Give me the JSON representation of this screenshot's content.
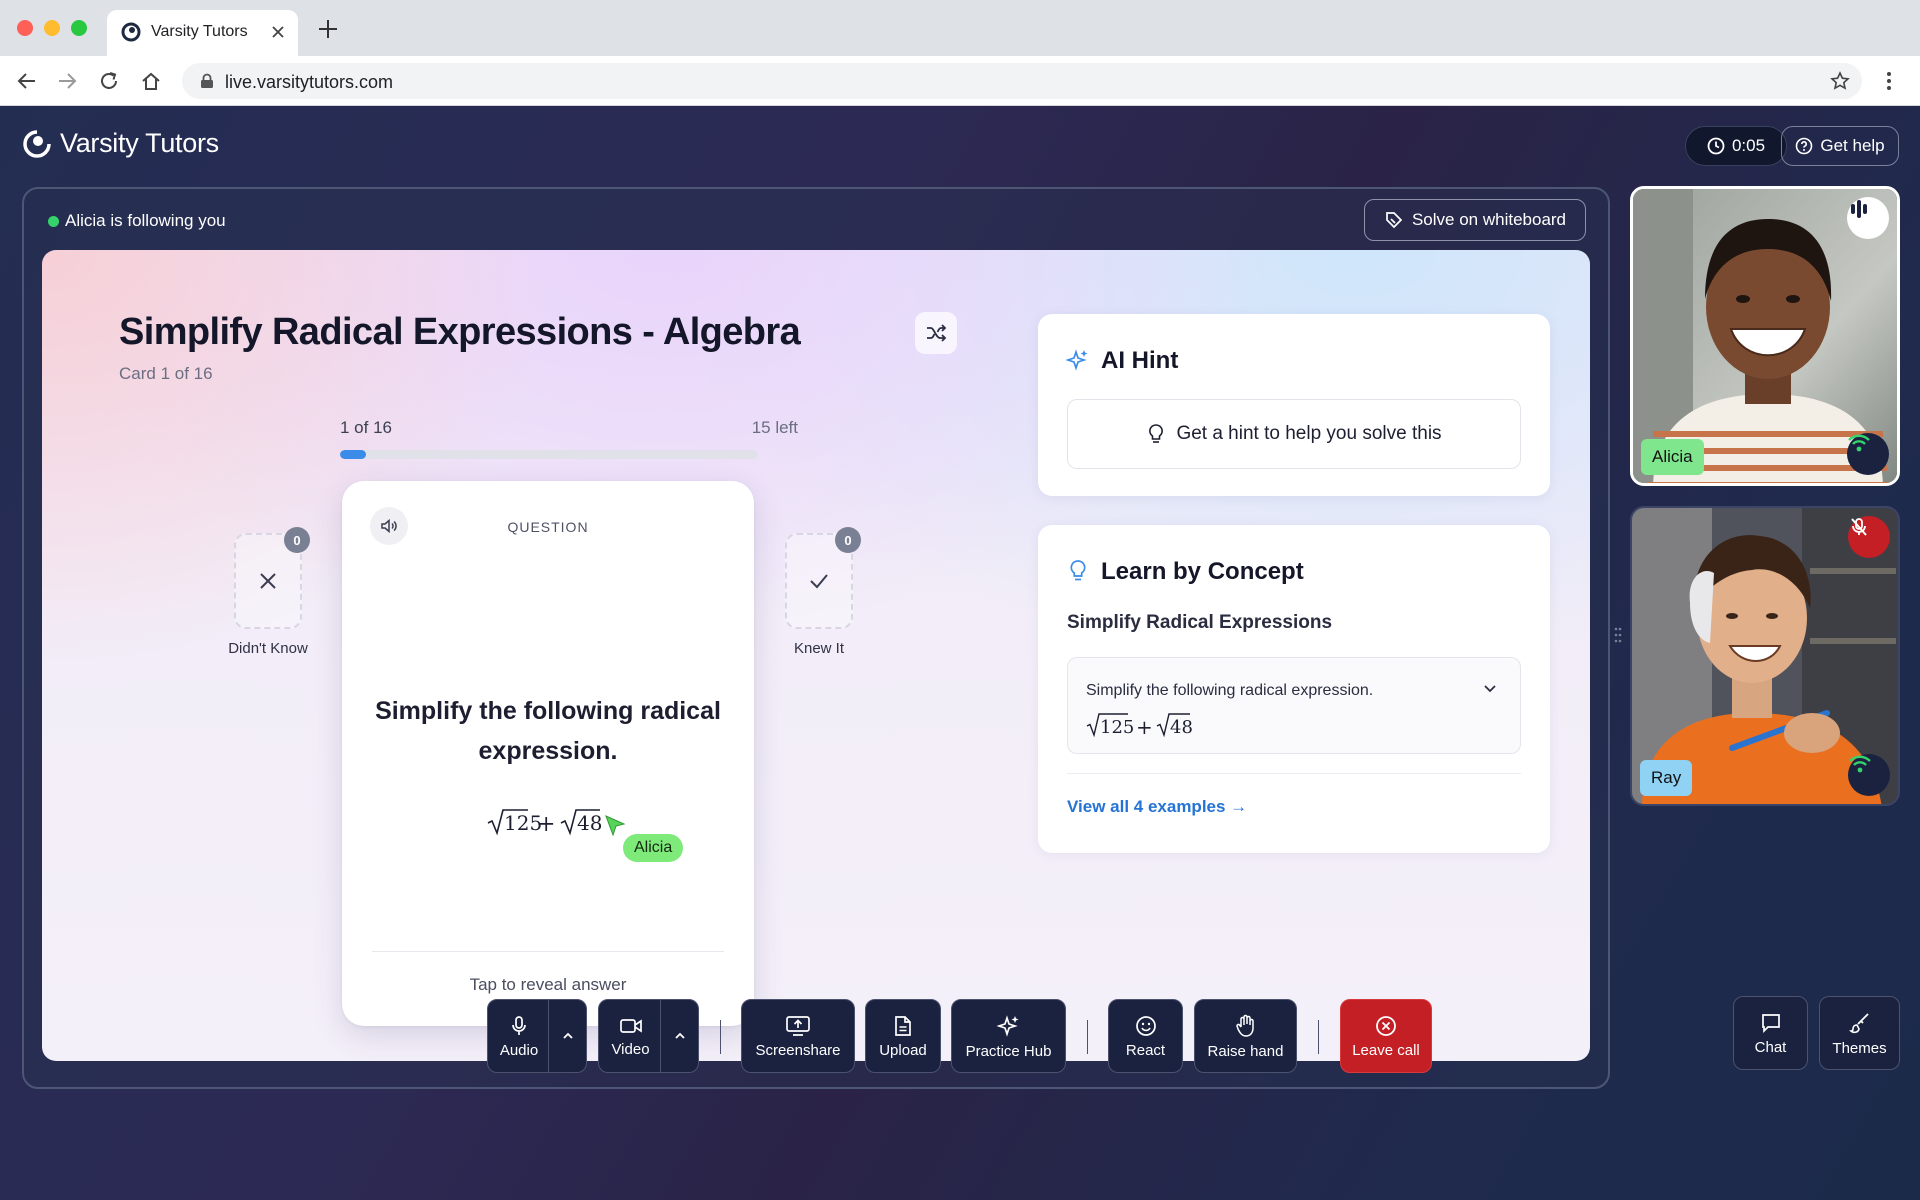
{
  "browser": {
    "tab_title": "Varsity Tutors",
    "url": "live.varsitytutors.com"
  },
  "app": {
    "brand": "Varsity Tutors",
    "timer": "0:05",
    "help_label": "Get help",
    "follow_status": "Alicia is following you",
    "whiteboard_label": "Solve on whiteboard"
  },
  "deck": {
    "title": "Simplify Radical Expressions - Algebra",
    "subtitle": "Card 1 of 16",
    "progress_label": "1 of 16",
    "remaining_label": "15 left",
    "progress_fraction": 0.0625,
    "didnt_know_label": "Didn't Know",
    "didnt_know_count": "0",
    "knew_it_label": "Knew It",
    "knew_it_count": "0"
  },
  "card": {
    "label": "QUESTION",
    "question": "Simplify the following radical expression.",
    "expression": "√125 + √48",
    "reveal": "Tap to reveal answer",
    "cursor_user": "Alicia"
  },
  "hint": {
    "title": "AI Hint",
    "button": "Get a hint to help you solve this"
  },
  "concept": {
    "title": "Learn by Concept",
    "subtitle": "Simplify Radical Expressions",
    "example_text": "Simplify the following radical expression.",
    "example_expression": "√125 + √48",
    "view_all": "View all 4 examples →"
  },
  "participants": [
    {
      "name": "Alicia",
      "status": "speaking",
      "tag_color": "#7fe68e"
    },
    {
      "name": "Ray",
      "status": "muted",
      "tag_color": "#8fd2f4"
    }
  ],
  "toolbar": {
    "audio": "Audio",
    "video": "Video",
    "screenshare": "Screenshare",
    "upload": "Upload",
    "practice_hub": "Practice Hub",
    "react": "React",
    "raise_hand": "Raise hand",
    "leave_call": "Leave call",
    "chat": "Chat",
    "themes": "Themes"
  },
  "colors": {
    "accent_blue": "#3b8be8",
    "leave_red": "#c41f24",
    "online_green": "#35d36b"
  }
}
